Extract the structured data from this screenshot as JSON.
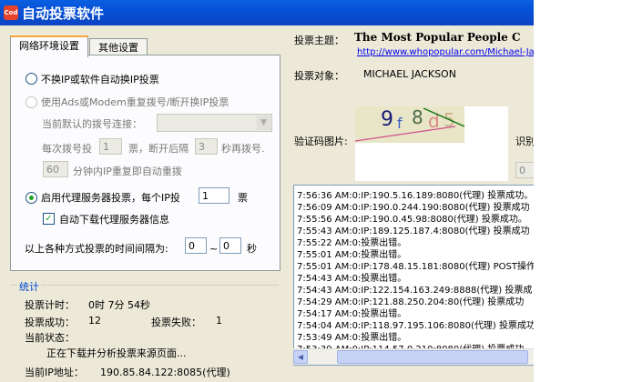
{
  "window": {
    "title": "自动投票软件",
    "icon_text": "Cod"
  },
  "tabs": [
    {
      "label": "网络环境设置"
    },
    {
      "label": "其他设置"
    }
  ],
  "network": {
    "option1_label": "不换IP或软件自动换IP投票",
    "option2_label": "使用Ads或Modem重复拨号/断开换IP投票",
    "dialup_label": "当前默认的拨号连接：",
    "dial_every_label": "每次拨号投",
    "dial_every_value": "1",
    "disconnect_label": "票，断开后隔",
    "disconnect_value": "3",
    "redial_label": "秒再拨号.",
    "repeat_value": "60",
    "repeat_label": "分钟内IP重复即自动重拨",
    "option3_label": "启用代理服务器投票，每个IP投",
    "proxy_votes_value": "1",
    "proxy_votes_unit": "票",
    "auto_download_label": "自动下载代理服务器信息",
    "interval_label": "以上各种方式投票的时间间隔为:",
    "interval_from": "0",
    "interval_sep": "~",
    "interval_to": "0",
    "interval_unit": "秒"
  },
  "stats": {
    "section_title": "统计",
    "timer_label": "投票计时：",
    "timer_value": "0时 7分 54秒",
    "success_label": "投票成功：",
    "success_value": "12",
    "fail_label": "投票失败：",
    "fail_value": "1",
    "status_label": "当前状态：",
    "status_value": "正在下载并分析投票来源页面...",
    "ip_label": "当前IP地址：",
    "ip_value": "190.85.84.122:8085(代理)"
  },
  "vote": {
    "topic_label": "投票主题：",
    "topic_value": "The Most Popular People C",
    "topic_link": "http://www.whopopular.com/Michael-Ja",
    "target_label": "投票对象：",
    "target_value": "MICHAEL JACKSON",
    "captcha_label": "验证码图片:",
    "recognize_label": "识别",
    "recognize_value": "0",
    "captcha_chars": [
      "9",
      "f",
      "8",
      "d",
      "5"
    ]
  },
  "log_lines": [
    "7:56:36 AM:0:IP:190.5.16.189:8080(代理) 投票成功。",
    "7:56:09 AM:0:IP:190.0.244.190:8080(代理) 投票成功",
    "7:55:56 AM:0:IP:190.0.45.98:8080(代理) 投票成功。",
    "7:55:43 AM:0:IP:189.125.187.4:8080(代理) 投票成功",
    "7:55:22 AM:0:投票出错。",
    "7:55:01 AM:0:投票出错。",
    "7:55:01 AM:0:IP:178.48.15.181:8080(代理) POST操作",
    "7:54:43 AM:0:投票出错。",
    "7:54:43 AM:0:IP:122.154.163.249:8888(代理) 投票成",
    "7:54:29 AM:0:IP:121.88.250.204:80(代理) 投票成功",
    "7:54:17 AM:0:投票出错。",
    "7:54:04 AM:0:IP:118.97.195.106:8080(代理) 投票成功",
    "7:53:49 AM:0:投票出错。",
    "7:53:39 AM:0:IP:114.57.0.210:8080(代理) 投票成功"
  ]
}
